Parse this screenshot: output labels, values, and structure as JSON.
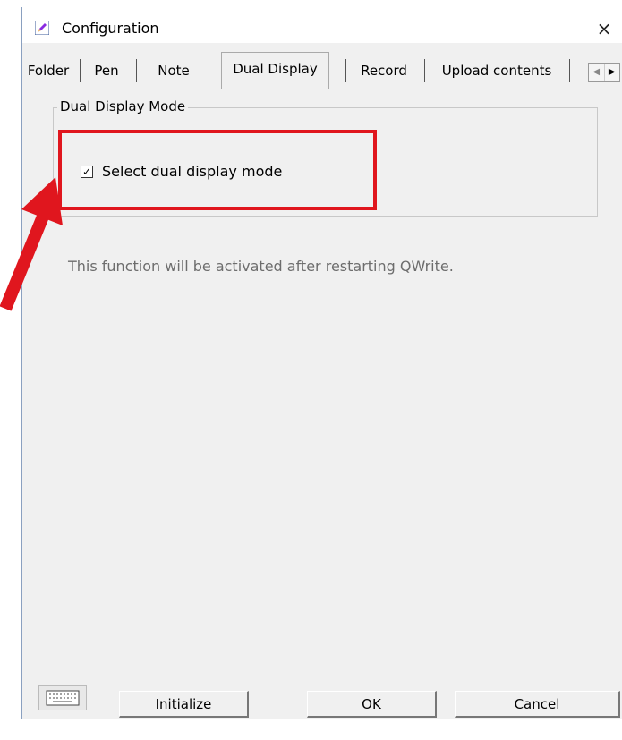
{
  "window": {
    "title": "Configuration",
    "close_glyph": "×"
  },
  "tabs": [
    {
      "label": "Folder",
      "active": false
    },
    {
      "label": "Pen",
      "active": false
    },
    {
      "label": "Note",
      "active": false
    },
    {
      "label": "Dual Display",
      "active": true
    },
    {
      "label": "Record",
      "active": false
    },
    {
      "label": "Upload contents",
      "active": false
    }
  ],
  "tab_scroll": {
    "left": "◀",
    "right": "▶"
  },
  "dual_display": {
    "group_title": "Dual Display Mode",
    "checkbox_label": "Select dual display mode",
    "checked": true,
    "check_glyph": "✓",
    "info": "This function will be activated after restarting QWrite."
  },
  "buttons": {
    "initialize": "Initialize",
    "ok": "OK",
    "cancel": "Cancel"
  },
  "icons": {
    "title": "edit-pencil-icon",
    "keyboard": "keyboard-icon"
  },
  "colors": {
    "highlight": "#e0161e",
    "info_text": "#6d6d6d",
    "dialog_bg": "#f0f0f0"
  }
}
